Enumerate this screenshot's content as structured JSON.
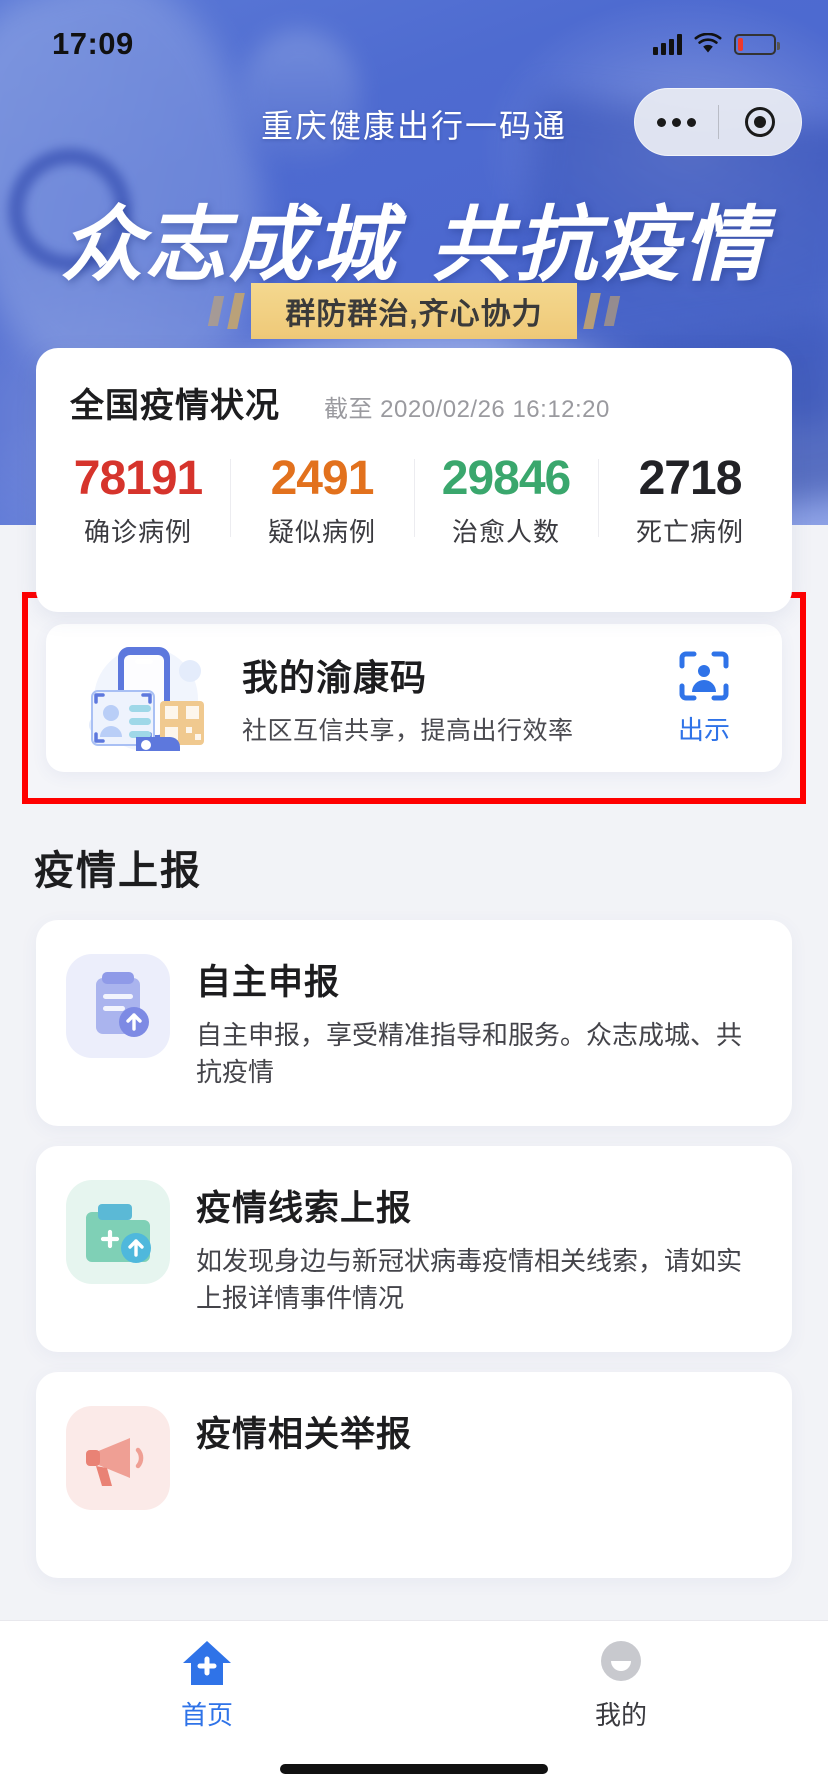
{
  "statusbar": {
    "time": "17:09",
    "signal_icon": "cellular-signal-icon",
    "wifi_icon": "wifi-icon",
    "battery_icon": "battery-low-icon"
  },
  "nav": {
    "title": "重庆健康出行一码通",
    "capsule": {
      "menu_icon": "more-dots-icon",
      "close_icon": "target-circle-icon"
    }
  },
  "hero": {
    "headline_left": "众志成城",
    "headline_right": "共抗疫情",
    "sub_banner": "群防群治,齐心协力",
    "gold_color": "#f0cf83"
  },
  "stats": {
    "title": "全国疫情状况",
    "timestamp": "截至 2020/02/26 16:12:20",
    "items": [
      {
        "value": "78191",
        "label": "确诊病例",
        "color": "#d6342c"
      },
      {
        "value": "2491",
        "label": "疑似病例",
        "color": "#e2711d"
      },
      {
        "value": "29846",
        "label": "治愈人数",
        "color": "#3aa76d"
      },
      {
        "value": "2718",
        "label": "死亡病例",
        "color": "#222226"
      }
    ]
  },
  "health_code": {
    "illustration_icon": "phone-id-qrcode-illustration",
    "title": "我的渝康码",
    "subtitle": "社区互信共享，提高出行效率",
    "action_icon": "scan-face-icon",
    "action_label": "出示",
    "action_color": "#2f73e8",
    "highlight_border_color": "#ff0000"
  },
  "section": {
    "title": "疫情上报"
  },
  "report_cards": [
    {
      "icon": "clipboard-upload-icon",
      "icon_bg": "#eceefb",
      "icon_fg": "#8f9ae8",
      "title": "自主申报",
      "desc": "自主申报，享受精准指导和服务。众志成城、共抗疫情"
    },
    {
      "icon": "folder-plus-upload-icon",
      "icon_bg": "#e6f5ef",
      "icon_fg": "#63c3a6",
      "title": "疫情线索上报",
      "desc": "如发现身边与新冠状病毒疫情相关线索，请如实上报详情事件情况"
    },
    {
      "icon": "megaphone-report-icon",
      "icon_bg": "#fbeae8",
      "icon_fg": "#ec8b7f",
      "title": "疫情相关举报",
      "desc": ""
    }
  ],
  "tabbar": {
    "items": [
      {
        "icon": "home-plus-icon",
        "label": "首页",
        "active": true,
        "color": "#2f73e8"
      },
      {
        "icon": "user-avatar-icon",
        "label": "我的",
        "active": false,
        "color": "#c8c9ce"
      }
    ]
  }
}
